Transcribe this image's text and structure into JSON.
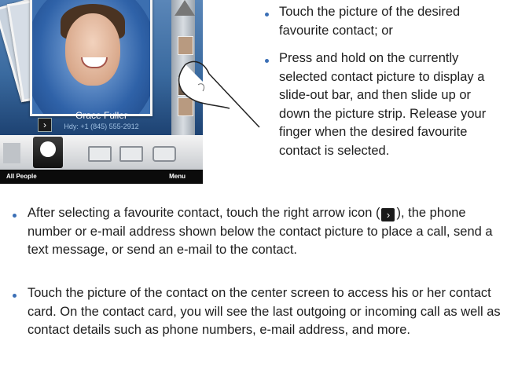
{
  "phone": {
    "contact_name": "Grace Fuller",
    "contact_phone": "Hdy: +1 (845) 555-2912",
    "arrow_glyph": "›",
    "softkey_left": "All People",
    "softkey_right": "Menu"
  },
  "bullets_right": [
    "Touch the picture of the desired favourite contact; or",
    "Press and hold on the currently selected contact picture to display a slide-out bar, and then slide up or down the picture strip. Release your finger when the desired favourite contact is selected."
  ],
  "bullet3": {
    "before": "After selecting a favourite contact, touch the right arrow icon (",
    "after": "), the phone number or e-mail address shown below the contact picture to place a call, send a text message, or send an e-mail to the contact."
  },
  "bullet4": "Touch the picture of the contact on the center screen to access his or her contact card. On the contact card, you will see the last outgoing or incoming call as well as contact details such as phone numbers, e-mail address, and more.",
  "colors": {
    "bullet": "#3b6fb6",
    "text": "#1e1e1e"
  }
}
